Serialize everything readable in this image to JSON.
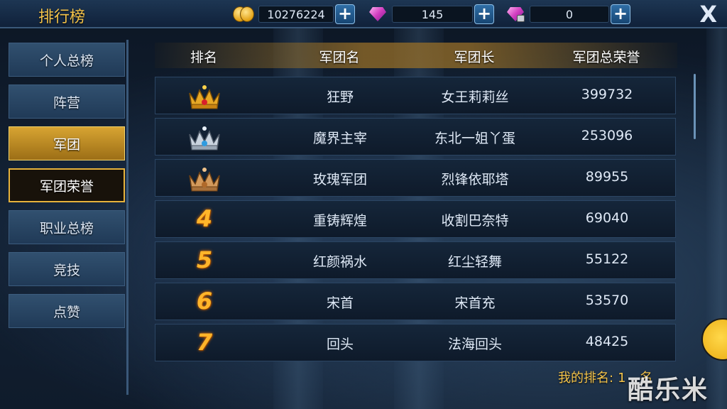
{
  "header": {
    "title": "排行榜",
    "gold": "10276224",
    "diamonds": "145",
    "bound_diamonds": "0"
  },
  "sidebar": {
    "items": [
      {
        "label": "个人总榜",
        "state": "normal"
      },
      {
        "label": "阵营",
        "state": "normal"
      },
      {
        "label": "军团",
        "state": "group"
      },
      {
        "label": "军团荣誉",
        "state": "selected"
      },
      {
        "label": "职业总榜",
        "state": "normal"
      },
      {
        "label": "竞技",
        "state": "normal"
      },
      {
        "label": "点赞",
        "state": "normal"
      }
    ]
  },
  "table": {
    "columns": [
      "排名",
      "军团名",
      "军团长",
      "军团总荣誉"
    ],
    "rows": [
      {
        "rank": "1",
        "rank_icon": "gold-crown-icon",
        "guild": "狂野",
        "leader": "女王莉莉丝",
        "honor": "399732"
      },
      {
        "rank": "2",
        "rank_icon": "silver-crown-icon",
        "guild": "魔界主宰",
        "leader": "东北一姐丫蛋",
        "honor": "253096"
      },
      {
        "rank": "3",
        "rank_icon": "bronze-crown-icon",
        "guild": "玫瑰军团",
        "leader": "烈锋依耶塔",
        "honor": "89955"
      },
      {
        "rank": "4",
        "guild": "重铸辉煌",
        "leader": "收割巴奈特",
        "honor": "69040"
      },
      {
        "rank": "5",
        "guild": "红颜祸水",
        "leader": "红尘轻舞",
        "honor": "55122"
      },
      {
        "rank": "6",
        "guild": "宋首",
        "leader": "宋首充",
        "honor": "53570"
      },
      {
        "rank": "7",
        "guild": "回头",
        "leader": "法海回头",
        "honor": "48425"
      }
    ]
  },
  "my_rank": {
    "label": "我的排名:",
    "value": "1",
    "suffix": "名"
  },
  "watermark": "酷乐米",
  "colors": {
    "accent_gold": "#f2c24a",
    "rank_orange": "#ffb52a",
    "selected_border": "#e7b23b"
  }
}
